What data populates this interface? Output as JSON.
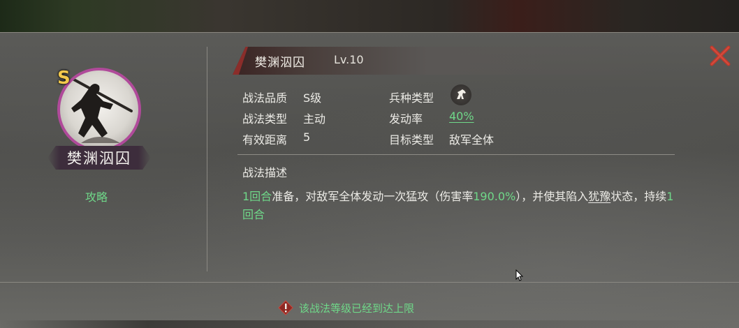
{
  "skill": {
    "name": "樊渊泅囚",
    "level": "Lv.10",
    "grade_badge": "S",
    "nameplate": "樊渊泅囚"
  },
  "left": {
    "guide_link": "攻略"
  },
  "stats": {
    "quality_label": "战法品质",
    "quality_value": "S级",
    "type_label": "战法类型",
    "type_value": "主动",
    "range_label": "有效距离",
    "range_value": "5",
    "troop_label": "兵种类型",
    "troop_icon": "cavalry-horse-icon",
    "rate_label": "发动率",
    "rate_value": "40%",
    "target_label": "目标类型",
    "target_value": "敌军全体"
  },
  "description": {
    "title": "战法描述",
    "seg1_hl": "1回合",
    "seg2": "准备，对敌军全体发动一次猛攻（伤害率",
    "seg3_hl": "190.0%",
    "seg4": "），并使其陷入",
    "seg5_ul": "犹豫",
    "seg6": "状态，持续",
    "seg7_hl": "1回合"
  },
  "footer": {
    "warning": "该战法等级已经到达上限"
  },
  "colors": {
    "accent_green": "#6fd889",
    "close_red": "#c0392b",
    "portrait_ring": "#b04a9a",
    "grade_gold": "#f2c94c"
  }
}
